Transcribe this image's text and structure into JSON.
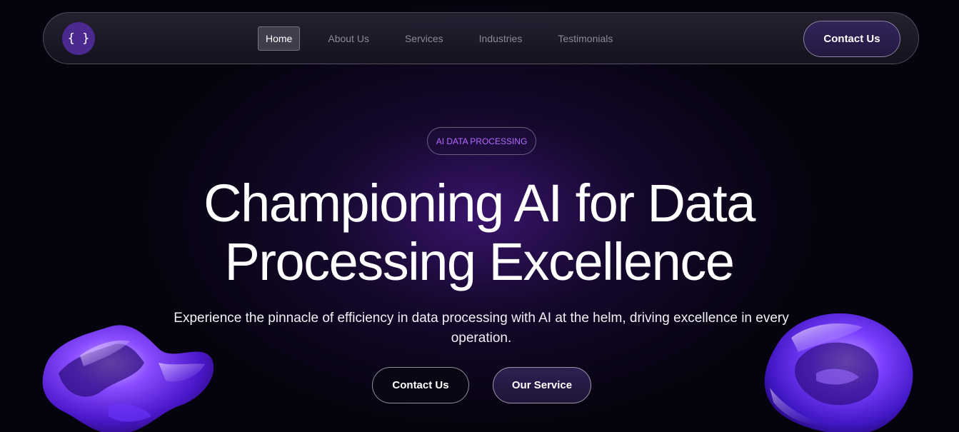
{
  "navbar": {
    "logo_text": "{ }",
    "links": [
      {
        "label": "Home",
        "active": true
      },
      {
        "label": "About Us",
        "active": false
      },
      {
        "label": "Services",
        "active": false
      },
      {
        "label": "Industries",
        "active": false
      },
      {
        "label": "Testimonials",
        "active": false
      }
    ],
    "contact_label": "Contact Us"
  },
  "hero": {
    "badge": "AI DATA PROCESSING",
    "title": "Championing AI for Data Processing Excellence",
    "subtitle": "Experience the pinnacle of efficiency in data processing with AI at the helm, driving excellence in every operation.",
    "buttons": {
      "contact_label": "Contact Us",
      "service_label": "Our Service"
    }
  },
  "decor": {
    "left_blob_icon": "abstract-3d-shape-icon",
    "right_blob_icon": "abstract-3d-shape-icon"
  },
  "colors": {
    "background": "#05030d",
    "accent_purple": "#4b2a8f",
    "badge_text": "#b56bff",
    "glow": "#4a1a8c"
  }
}
